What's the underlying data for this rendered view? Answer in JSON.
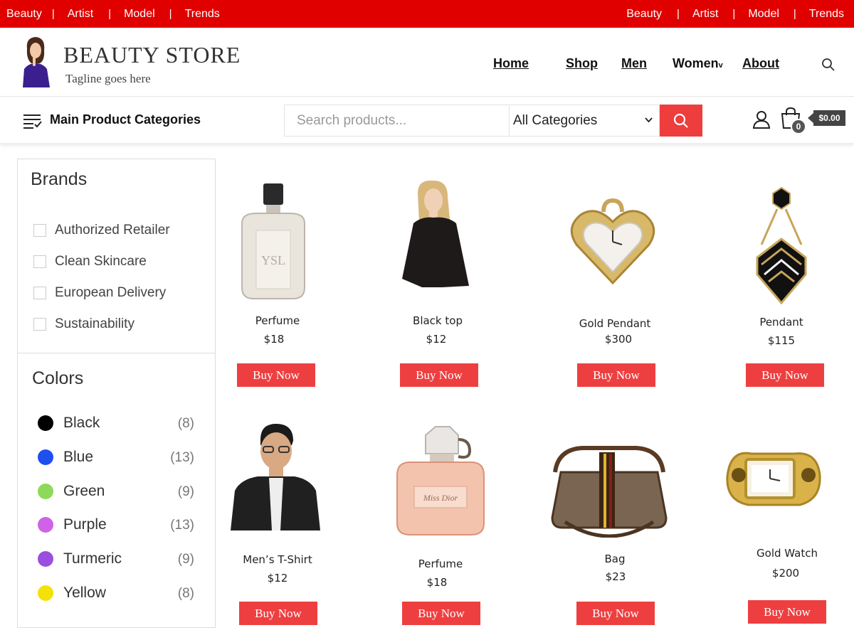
{
  "topbar": {
    "left_links": [
      "Beauty",
      "Artist",
      "Model",
      "Trends"
    ],
    "right_links": [
      "Beauty",
      "Artist",
      "Model",
      "Trends"
    ],
    "separator": "|",
    "color": "#e00000"
  },
  "header": {
    "title": "BEAUTY STORE",
    "tagline": "Tagline goes here",
    "nav": {
      "home": "Home",
      "shop": "Shop",
      "men": "Men",
      "women": "Women",
      "women_chevron": "v",
      "about": "About"
    }
  },
  "catbar": {
    "title": "Main Product Categories",
    "search_placeholder": "Search products...",
    "category_select": "All Categories",
    "cart_count": "0",
    "cart_total": "$0.00",
    "accent": "#ee3d3d"
  },
  "sidebar": {
    "brands_heading": "Brands",
    "brands": [
      "Authorized Retailer",
      "Clean Skincare",
      "European Delivery",
      "Sustainability"
    ],
    "colors_heading": "Colors",
    "colors": [
      {
        "name": "Black",
        "count": "(8)",
        "swatch": "#000000"
      },
      {
        "name": "Blue",
        "count": "(13)",
        "swatch": "#1e50f0"
      },
      {
        "name": "Green",
        "count": "(9)",
        "swatch": "#8fd95a"
      },
      {
        "name": "Purple",
        "count": "(13)",
        "swatch": "#cf62e6"
      },
      {
        "name": "Turmeric",
        "count": "(9)",
        "swatch": "#9a4fe0"
      },
      {
        "name": "Yellow",
        "count": "(8)",
        "swatch": "#f5e10a"
      }
    ]
  },
  "products": [
    {
      "name": "Perfume",
      "price": "$18",
      "button": "Buy Now",
      "icon": "perfume-bottle-icon"
    },
    {
      "name": "Black top",
      "price": "$12",
      "button": "Buy Now",
      "icon": "woman-black-top-icon"
    },
    {
      "name": "Gold Pendant",
      "price": "$300",
      "button": "Buy Now",
      "icon": "heart-watch-pendant-icon"
    },
    {
      "name": "Pendant",
      "price": "$115",
      "button": "Buy Now",
      "icon": "earring-pendant-icon"
    },
    {
      "name": "Men’s T-Shirt",
      "price": "$12",
      "button": "Buy Now",
      "icon": "man-jacket-icon"
    },
    {
      "name": "Perfume",
      "price": "$18",
      "button": "Buy Now",
      "icon": "pink-perfume-icon"
    },
    {
      "name": "Bag",
      "price": "$23",
      "button": "Buy Now",
      "icon": "brown-bag-icon"
    },
    {
      "name": "Gold Watch",
      "price": "$200",
      "button": "Buy Now",
      "icon": "gold-watch-icon"
    }
  ]
}
